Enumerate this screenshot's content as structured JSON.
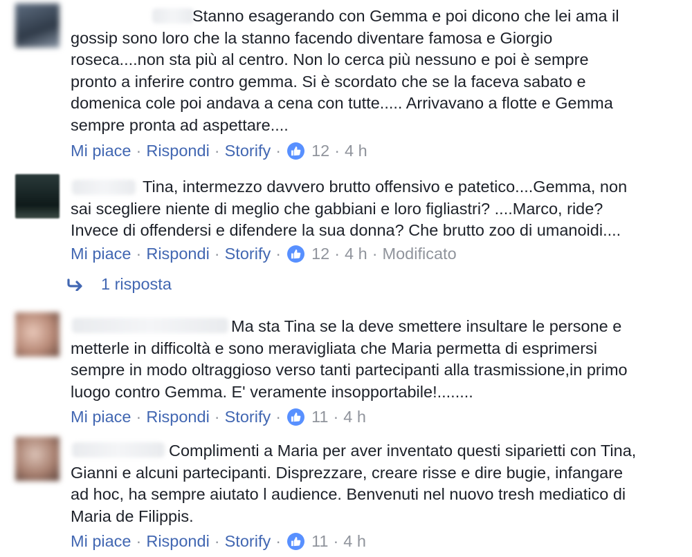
{
  "actions": {
    "like": "Mi piace",
    "reply": "Rispondi",
    "storify": "Storify",
    "separator": "·"
  },
  "colors": {
    "link": "#4267b2",
    "meta": "#90949c",
    "text": "#1d2129",
    "like_badge": "#5890ff"
  },
  "comments": [
    {
      "lines": [
        "Stanno esagerando con Gemma e poi dicono che lei ama il",
        "gossip sono loro che la stanno facendo diventare famosa e Giorgio",
        "roseca....non sta più al centro. Non lo cerca più nessuno e poi è sempre",
        "pronto a inferire contro gemma. Si è scordato che se la faceva sabato e",
        "domenica cole poi andava a cena con tutte..... Arrivavano a flotte e Gemma",
        "sempre pronta ad aspettare...."
      ],
      "likes": "12",
      "time": "4 h",
      "edited": ""
    },
    {
      "lines": [
        "Tina, intermezzo davvero brutto offensivo e patetico....Gemma, non",
        "sai scegliere niente di meglio che gabbiani e loro figliastri? ....Marco, ride?",
        "Invece di offendersi e difendere la sua donna? Che brutto zoo di umanoidi...."
      ],
      "likes": "12",
      "time": "4 h",
      "edited": "Modificato"
    },
    {
      "lines": [
        "Ma sta Tina se la deve smettere insultare le persone e",
        "metterle in difficoltà e sono meravigliata che Maria permetta di esprimersi",
        "sempre in modo oltraggioso verso tanti partecipanti alla trasmissione,in primo",
        "luogo contro Gemma. E' veramente insopportabile!........"
      ],
      "likes": "11",
      "time": "4 h",
      "edited": ""
    },
    {
      "lines": [
        "Complimenti a Maria per aver inventato questi siparietti con Tina,",
        "Gianni e alcuni partecipanti. Disprezzare, creare risse e dire bugie, infangare",
        "ad hoc, ha sempre aiutato l audience. Benvenuti nel nuovo tresh mediatico di",
        "Maria de Filippis."
      ],
      "likes": "11",
      "time": "4 h",
      "edited": ""
    }
  ],
  "replies_link": "1 risposta"
}
